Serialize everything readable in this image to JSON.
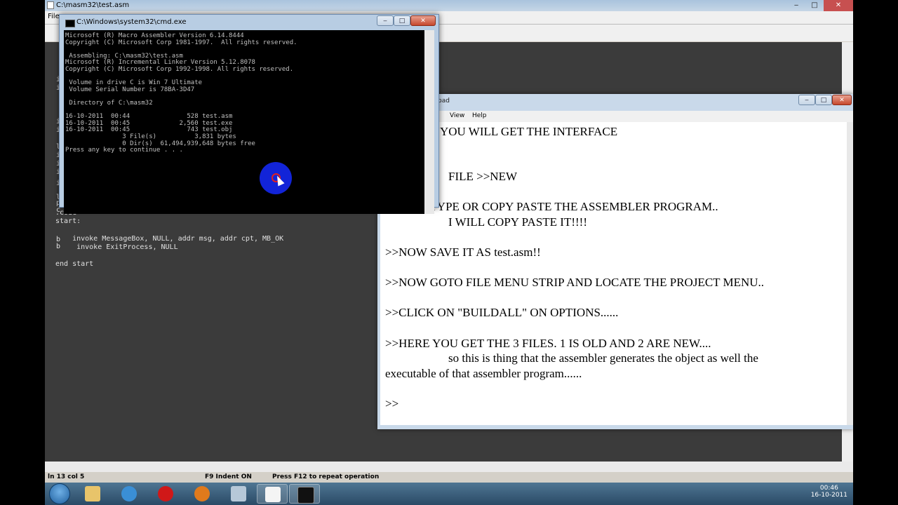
{
  "qeditor": {
    "title": "C:\\masm32\\test.asm",
    "menu_first": "File",
    "gutter": [
      "i",
      "i",
      "i",
      "i",
      "l",
      "i",
      "i",
      "i",
      "i",
      "l",
      "p",
      "c",
      "b",
      "b"
    ],
    "code_lines": [
      ".code",
      "start:",
      "",
      "    invoke MessageBox, NULL, addr msg, addr cpt, MB_OK",
      "     invoke ExitProcess, NULL",
      "",
      "end start"
    ],
    "status": {
      "pos": "ln 13 col 5",
      "indent": "F9 Indent ON",
      "hint": "Press F12 to repeat operation"
    }
  },
  "cmd": {
    "title": "C:\\Windows\\system32\\cmd.exe",
    "lines": [
      "Microsoft (R) Macro Assembler Version 6.14.8444",
      "Copyright (C) Microsoft Corp 1981-1997.  All rights reserved.",
      "",
      " Assembling: C:\\masm32\\test.asm",
      "Microsoft (R) Incremental Linker Version 5.12.8078",
      "Copyright (C) Microsoft Corp 1992-1998. All rights reserved.",
      "",
      " Volume in drive C is Win 7 Ultimate",
      " Volume Serial Number is 78BA-3D47",
      "",
      " Directory of C:\\masm32",
      "",
      "16-10-2011  00:44               528 test.asm",
      "16-10-2011  00:45             2,560 test.exe",
      "16-10-2011  00:45               743 test.obj",
      "               3 File(s)          3,831 bytes",
      "               0 Dir(s)  61,494,939,648 bytes free",
      "Press any key to continue . . ."
    ]
  },
  "notepad": {
    "title_fragment": "pad",
    "menu": {
      "fragment": "t",
      "view": "View",
      "help": "Help"
    },
    "lines": [
      "YOU WILL GET THE INTERFACE",
      ")",
      "FILE >>NEW",
      ">>NOW TYPE OR COPY PASTE THE ASSEMBLER PROGRAM..",
      "I WILL COPY PASTE IT!!!!",
      ">>NOW SAVE IT AS test.asm!!",
      ">>NOW GOTO FILE MENU STRIP AND LOCATE THE PROJECT MENU..",
      ">>CLICK ON \"BUILDALL\" ON OPTIONS......",
      ">>HERE YOU GET THE 3 FILES. 1 IS OLD AND 2 ARE NEW....",
      "so this is thing that the assembler generates the object as well the",
      "executable of that assembler program......",
      ">>"
    ]
  },
  "window_buttons": {
    "minimize": "‒",
    "maximize": "□",
    "close": "✕"
  },
  "taskbar": {
    "time": "00:46",
    "date": "16-10-2011",
    "apps": [
      "start-orb",
      "windows-explorer",
      "internet-explorer",
      "opera",
      "media-player",
      "app-generic",
      "qeditor",
      "cmd"
    ]
  },
  "colors": {
    "cmd_bg": "#000000",
    "editor_bg": "#3b3b3b",
    "cursor_ring": "#1224d8",
    "taskbar": "#2a4a66"
  }
}
